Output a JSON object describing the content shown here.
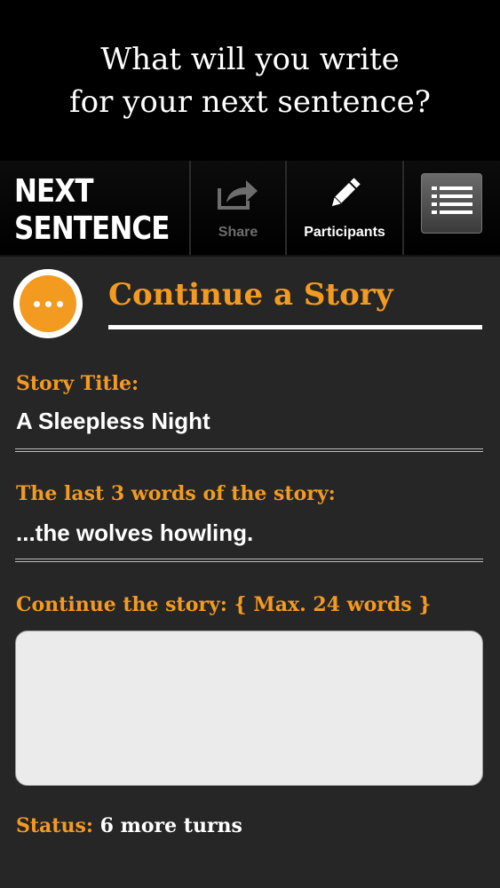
{
  "promo": {
    "line1": "What will you write",
    "line2": "for your next sentence?"
  },
  "toolbar": {
    "logo_line1": "NEXT",
    "logo_line2": "SENTENCE",
    "share_label": "Share",
    "participants_label": "Participants",
    "share_icon": "share-icon",
    "participants_icon": "pencil-icon",
    "menu_icon": "list-menu-icon"
  },
  "section": {
    "title": "Continue a Story",
    "icon": "ellipsis-icon"
  },
  "story": {
    "title_label": "Story Title:",
    "title_value": "A Sleepless Night",
    "last_words_label": "The last 3 words of the story:",
    "last_words_value": "...the wolves howling.",
    "continue_label": "Continue the story: { Max. 24 words }",
    "continue_value": ""
  },
  "status": {
    "label": "Status:",
    "value": "6 more turns"
  },
  "colors": {
    "accent": "#f39a21",
    "background": "#262626"
  }
}
